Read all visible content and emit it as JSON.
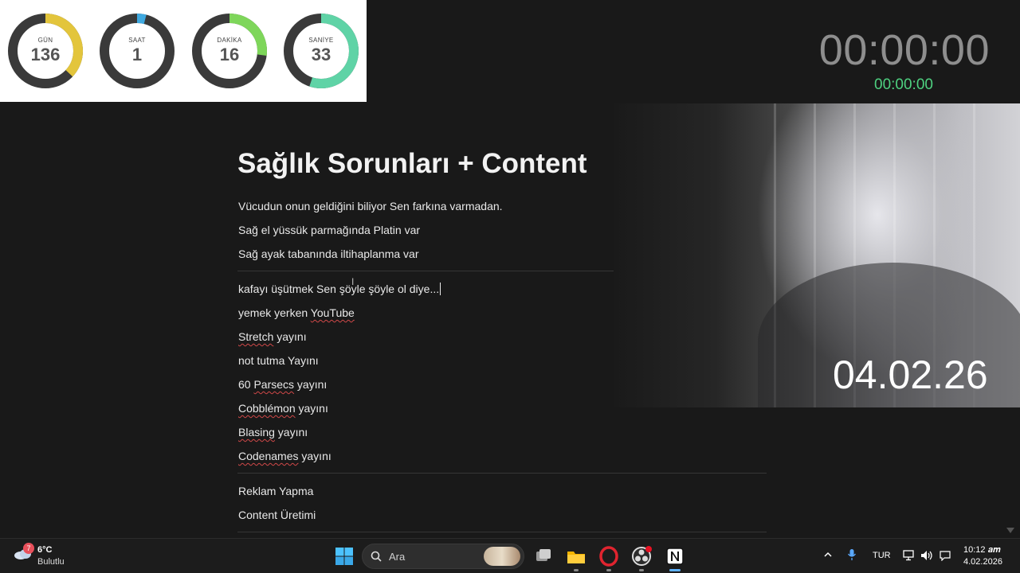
{
  "countdown": {
    "rings": [
      {
        "label": "GÜN",
        "value": "136",
        "color": "#e3c53c",
        "fraction": 0.37
      },
      {
        "label": "SAAT",
        "value": "1",
        "color": "#3fa9e0",
        "fraction": 0.04
      },
      {
        "label": "DAKİKA",
        "value": "16",
        "color": "#7ed65a",
        "fraction": 0.27
      },
      {
        "label": "SANİYE",
        "value": "33",
        "color": "#5fd3a6",
        "fraction": 0.55
      }
    ],
    "track_color": "#3a3a3a"
  },
  "clock": {
    "main": "00:00:00",
    "sub": "00:00:00"
  },
  "page": {
    "title": "Sağlık Sorunları + Content",
    "block1": [
      "Vücudun onun geldiğini biliyor Sen farkına varmadan.",
      "Sağ el yüssük parmağında Platin var",
      "Sağ ayak tabanında iltihaplanma var"
    ],
    "block2": {
      "first_line": "kafayı üşütmek Sen şöyle şöyle ol diye...",
      "l2a": "yemek yerken ",
      "l2b": "YouTube",
      "l3a": "Stretch",
      "l3b": " yayını",
      "l4": "not tutma Yayını",
      "l5a": "60 ",
      "l5b": "Parsecs",
      "l5c": " yayını",
      "l6a": "Cobblémon",
      "l6b": " yayını",
      "l7a": "Blasing",
      "l7b": " yayını",
      "l8a": "Codenames",
      "l8b": " yayını"
    },
    "block3": [
      "Reklam Yapma",
      "Content Üretimi"
    ]
  },
  "webcam": {
    "date_overlay": "04.02.26"
  },
  "taskbar": {
    "weather": {
      "badge": "7",
      "temp": "6°C",
      "desc": "Bulutlu"
    },
    "search_placeholder": "Ara",
    "apps": [
      "windows-start",
      "search",
      "task-view",
      "file-explorer",
      "opera",
      "obs",
      "notion"
    ],
    "tray": {
      "lang": "TUR",
      "time": "10:12 𝒂𝒎",
      "date": "4.02.2026"
    }
  }
}
